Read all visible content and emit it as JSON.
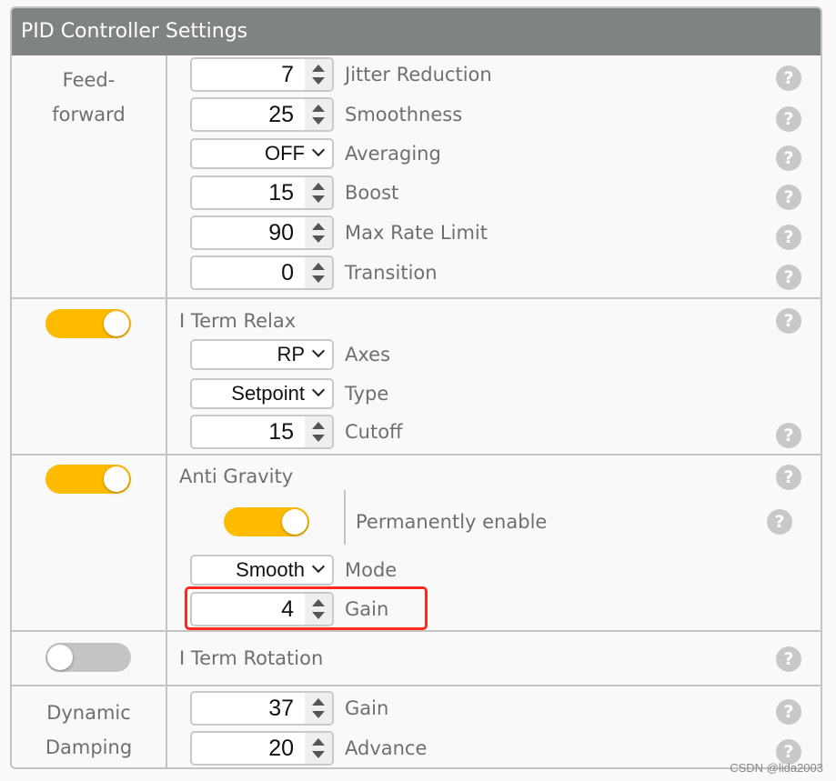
{
  "panel": {
    "title": "PID Controller Settings"
  },
  "feedforward": {
    "section_label_line1": "Feed-",
    "section_label_line2": "forward",
    "rows": [
      {
        "type": "number",
        "value": "7",
        "label": "Jitter Reduction"
      },
      {
        "type": "number",
        "value": "25",
        "label": "Smoothness"
      },
      {
        "type": "select",
        "value": "OFF",
        "label": "Averaging"
      },
      {
        "type": "number",
        "value": "15",
        "label": "Boost"
      },
      {
        "type": "number",
        "value": "90",
        "label": "Max Rate Limit"
      },
      {
        "type": "number",
        "value": "0",
        "label": "Transition"
      }
    ]
  },
  "iterm_relax": {
    "enabled": true,
    "title": "I Term Relax",
    "rows": [
      {
        "type": "select",
        "value": "RP",
        "label": "Axes"
      },
      {
        "type": "select",
        "value": "Setpoint",
        "label": "Type"
      },
      {
        "type": "number",
        "value": "15",
        "label": "Cutoff"
      }
    ]
  },
  "anti_gravity": {
    "enabled": true,
    "title": "Anti Gravity",
    "permanently_enable": {
      "enabled": true,
      "label": "Permanently enable"
    },
    "rows": [
      {
        "type": "select",
        "value": "Smooth",
        "label": "Mode"
      },
      {
        "type": "number",
        "value": "4",
        "label": "Gain",
        "highlighted": true
      }
    ]
  },
  "iterm_rotation": {
    "enabled": false,
    "title": "I Term Rotation"
  },
  "dynamic_damping": {
    "section_label_line1": "Dynamic",
    "section_label_line2": "Damping",
    "rows": [
      {
        "type": "number",
        "value": "37",
        "label": "Gain"
      },
      {
        "type": "number",
        "value": "20",
        "label": "Advance"
      }
    ]
  },
  "help_icon_glyph": "?",
  "colors": {
    "header_bg": "#7f8481",
    "toggle_on": "#ffbb00",
    "toggle_off": "#c4c4c4",
    "highlight_border": "#ff2a1f",
    "help_icon": "#c8c8c8"
  },
  "watermark": "CSDN @lida2003"
}
